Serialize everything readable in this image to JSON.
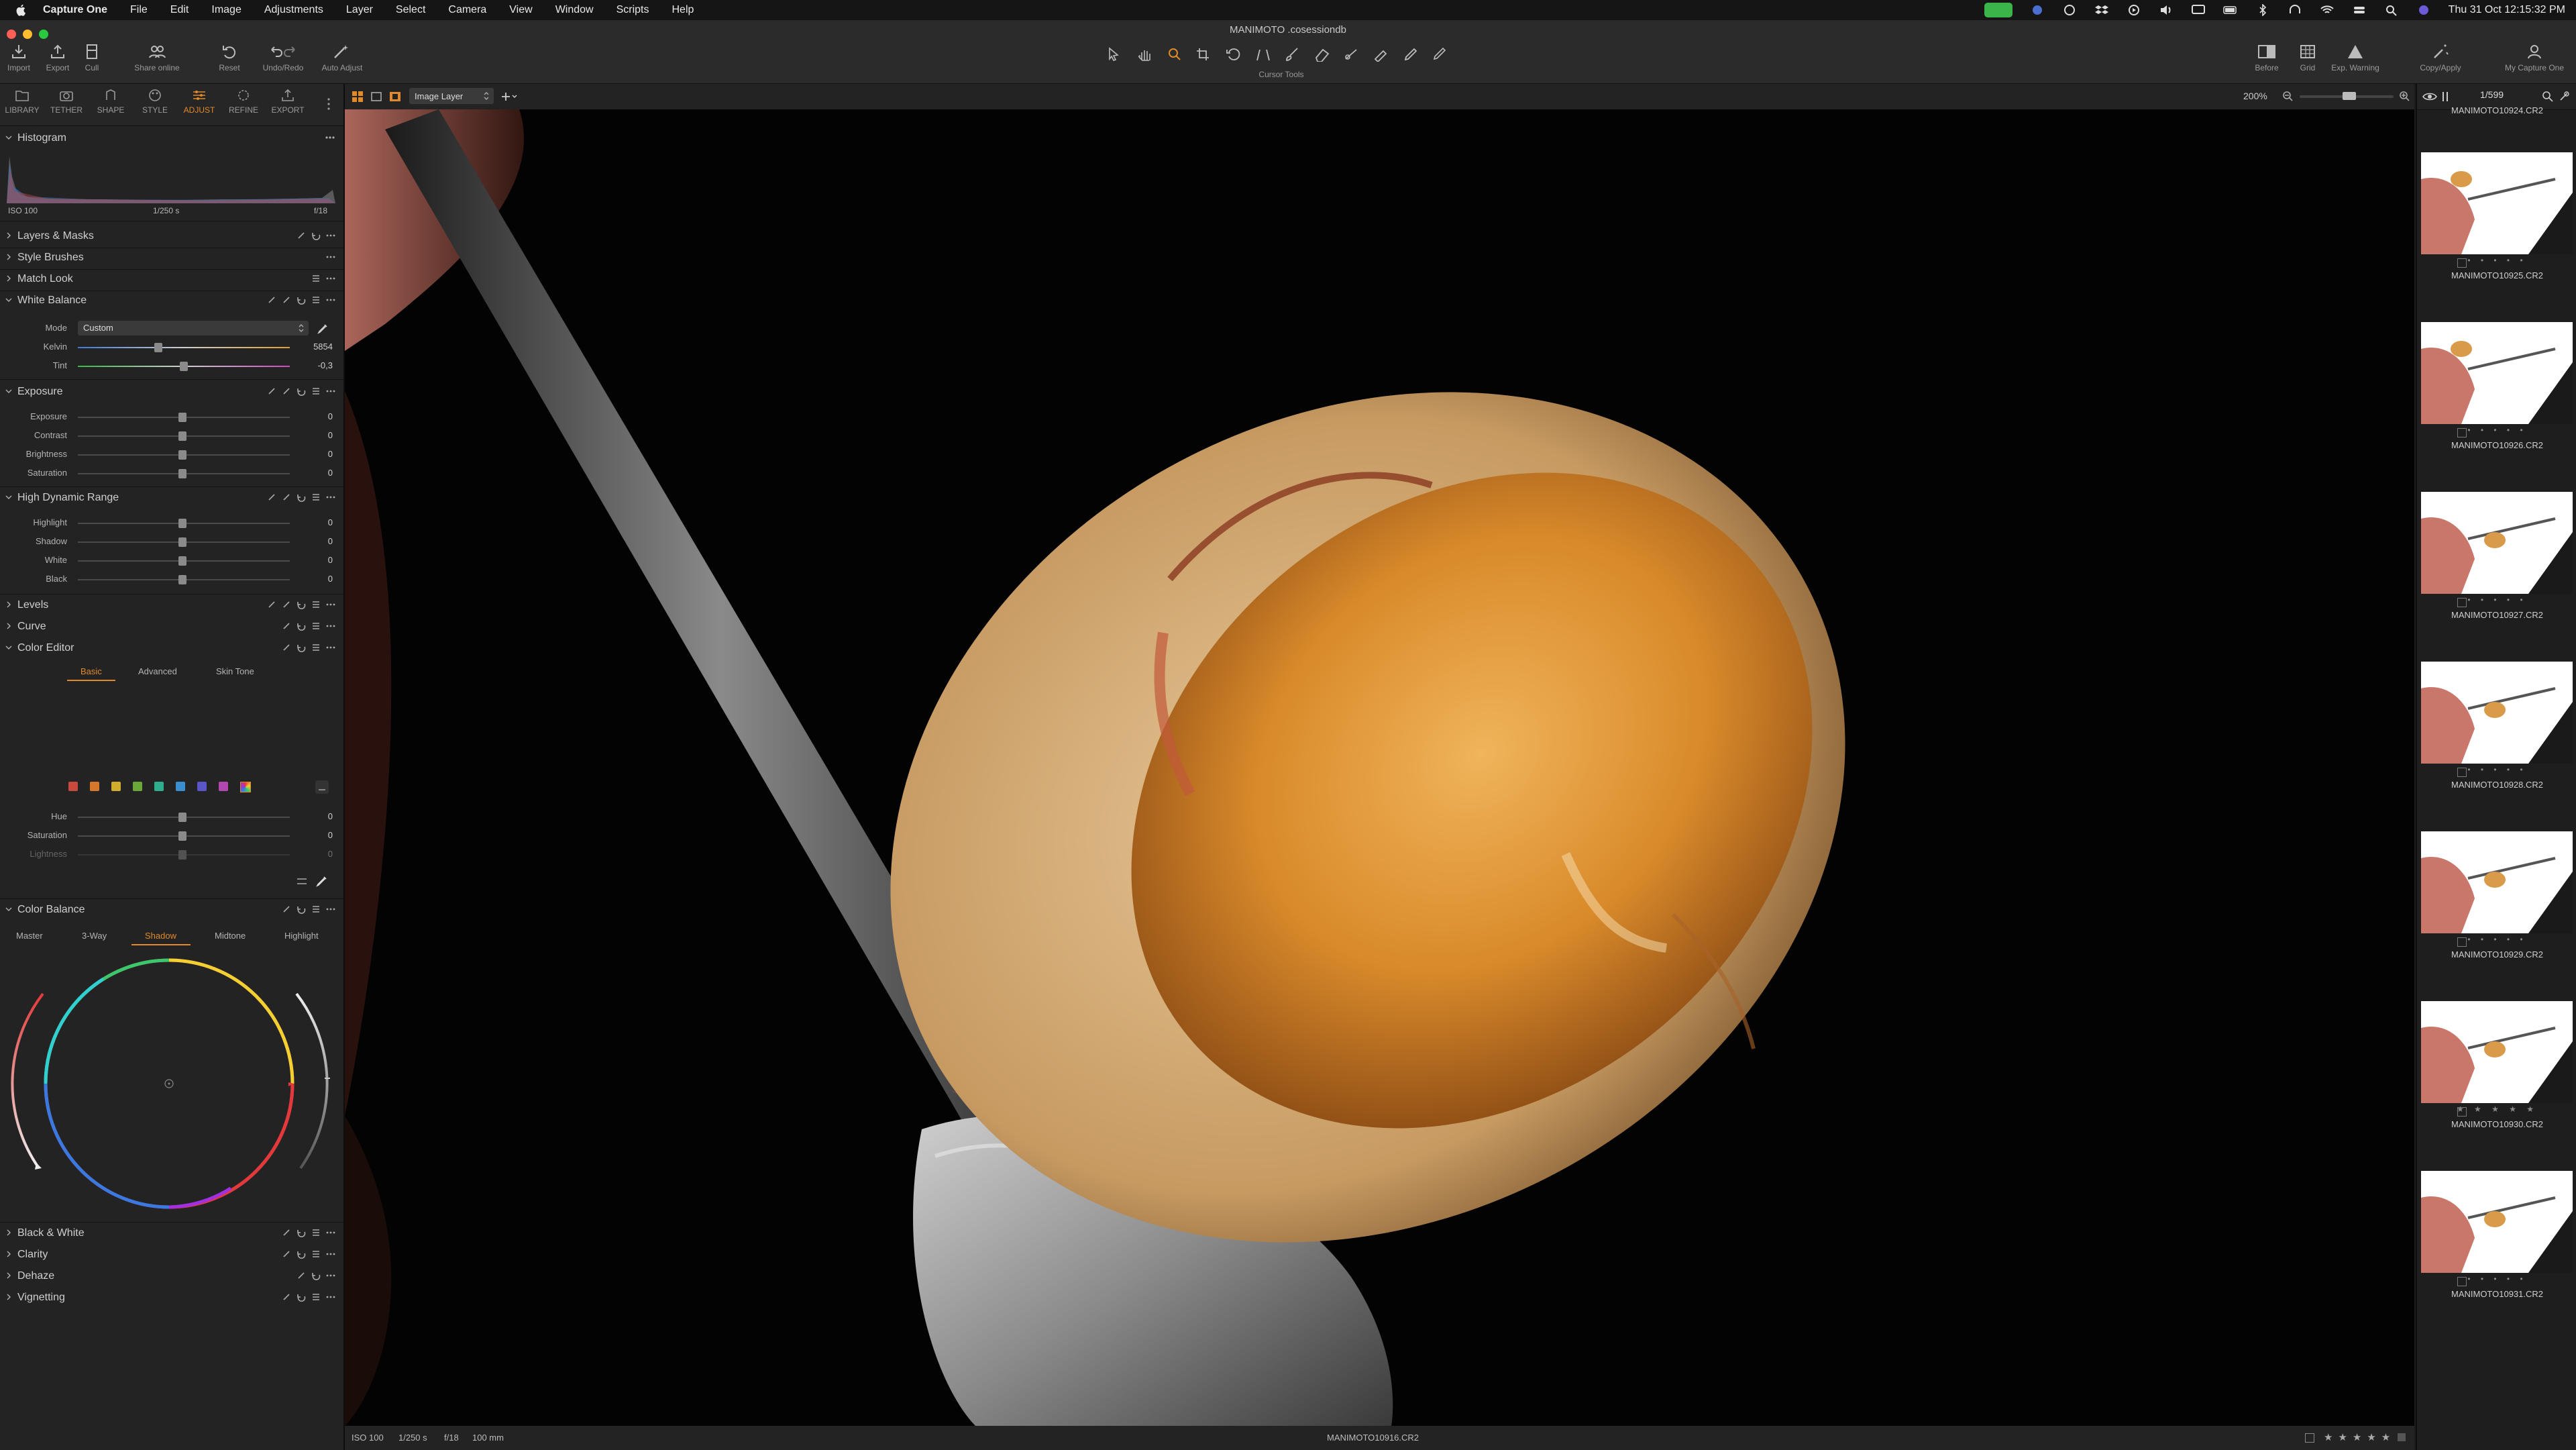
{
  "menubar": {
    "app": "Capture One",
    "items": [
      "File",
      "Edit",
      "Image",
      "Adjustments",
      "Layer",
      "Select",
      "Camera",
      "View",
      "Window",
      "Scripts",
      "Help"
    ],
    "clock": "Thu 31 Oct  12:15:32 PM"
  },
  "window": {
    "title": "MANIMOTO .cosessiondb"
  },
  "toolbar": {
    "import": "Import",
    "export": "Export",
    "cull": "Cull",
    "share": "Share online",
    "reset": "Reset",
    "undo_redo": "Undo/Redo",
    "auto_adjust": "Auto Adjust",
    "cursor_tools": "Cursor Tools",
    "before": "Before",
    "grid": "Grid",
    "exp_warning": "Exp. Warning",
    "copy_apply": "Copy/Apply",
    "my_capture_one": "My Capture One"
  },
  "tool_tabs": [
    "LIBRARY",
    "TETHER",
    "SHAPE",
    "STYLE",
    "ADJUST",
    "REFINE",
    "EXPORT"
  ],
  "histogram": {
    "title": "Histogram",
    "iso": "ISO 100",
    "shutter": "1/250 s",
    "aperture": "f/18"
  },
  "sections": {
    "layers": "Layers & Masks",
    "style_brushes": "Style Brushes",
    "match_look": "Match Look",
    "white_balance": "White Balance",
    "exposure": "Exposure",
    "hdr": "High Dynamic Range",
    "levels": "Levels",
    "curve": "Curve",
    "color_editor": "Color Editor",
    "color_balance": "Color Balance",
    "bw": "Black & White",
    "clarity": "Clarity",
    "dehaze": "Dehaze",
    "vignetting": "Vignetting"
  },
  "white_balance": {
    "mode_label": "Mode",
    "mode_value": "Custom",
    "kelvin_label": "Kelvin",
    "kelvin_value": "5854",
    "kelvin_pos": 0.38,
    "tint_label": "Tint",
    "tint_value": "-0,3",
    "tint_pos": 0.5
  },
  "exposure": [
    {
      "label": "Exposure",
      "value": "0"
    },
    {
      "label": "Contrast",
      "value": "0"
    },
    {
      "label": "Brightness",
      "value": "0"
    },
    {
      "label": "Saturation",
      "value": "0"
    }
  ],
  "hdr": [
    {
      "label": "Highlight",
      "value": "0"
    },
    {
      "label": "Shadow",
      "value": "0"
    },
    {
      "label": "White",
      "value": "0"
    },
    {
      "label": "Black",
      "value": "0"
    }
  ],
  "color_editor": {
    "tabs": [
      "Basic",
      "Advanced",
      "Skin Tone"
    ],
    "swatches": [
      "#c84a3c",
      "#d6782c",
      "#cfae2e",
      "#6aa83a",
      "#2fae8e",
      "#3a8ed0",
      "#5a56c8",
      "#b048b0"
    ],
    "rows": [
      {
        "label": "Hue",
        "value": "0"
      },
      {
        "label": "Saturation",
        "value": "0"
      },
      {
        "label": "Lightness",
        "value": "0"
      }
    ]
  },
  "color_balance": {
    "tabs": [
      "Master",
      "3-Way",
      "Shadow",
      "Midtone",
      "Highlight"
    ]
  },
  "viewer": {
    "layer": "Image Layer",
    "zoom": "200%",
    "counter": "1/599",
    "iso": "ISO 100",
    "shutter": "1/250 s",
    "aperture": "f/18",
    "focal": "100 mm",
    "filename": "MANIMOTO10916.CR2"
  },
  "browser": {
    "top_caption": "MANIMOTO10924.CR2",
    "thumbs": [
      {
        "name": "MANIMOTO10925.CR2",
        "rating": "• • • • •"
      },
      {
        "name": "MANIMOTO10926.CR2",
        "rating": "• • • • •"
      },
      {
        "name": "MANIMOTO10927.CR2",
        "rating": "• • • • •"
      },
      {
        "name": "MANIMOTO10928.CR2",
        "rating": "• • • • •"
      },
      {
        "name": "MANIMOTO10929.CR2",
        "rating": "• • • • •"
      },
      {
        "name": "MANIMOTO10930.CR2",
        "rating": "★ ★ ★ ★ ★"
      },
      {
        "name": "MANIMOTO10931.CR2",
        "rating": "• • • • •"
      }
    ]
  },
  "colors": {
    "accent": "#e08a2a",
    "panel": "#232323",
    "viewer_bg": "#020202"
  }
}
